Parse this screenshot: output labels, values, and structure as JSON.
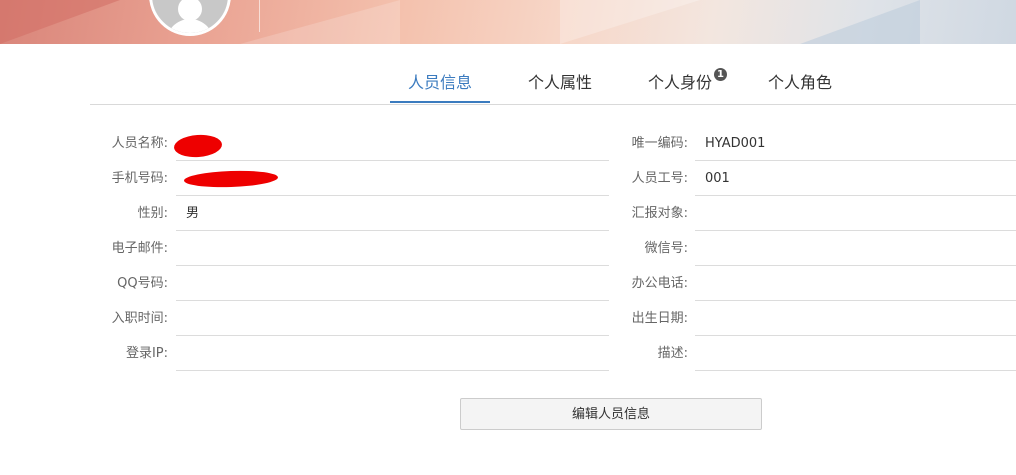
{
  "tabs": [
    {
      "label": "人员信息",
      "active": true
    },
    {
      "label": "个人属性",
      "active": false
    },
    {
      "label": "个人身份",
      "active": false,
      "badge": "1"
    },
    {
      "label": "个人角色",
      "active": false
    }
  ],
  "form_left": [
    {
      "label": "人员名称:",
      "value": ""
    },
    {
      "label": "手机号码:",
      "value": ""
    },
    {
      "label": "性别:",
      "value": "男"
    },
    {
      "label": "电子邮件:",
      "value": ""
    },
    {
      "label": "QQ号码:",
      "value": ""
    },
    {
      "label": "入职时间:",
      "value": ""
    },
    {
      "label": "登录IP:",
      "value": ""
    }
  ],
  "form_right": [
    {
      "label": "唯一编码:",
      "value": "HYAD001"
    },
    {
      "label": "人员工号:",
      "value": "001"
    },
    {
      "label": "汇报对象:",
      "value": ""
    },
    {
      "label": "微信号:",
      "value": ""
    },
    {
      "label": "办公电话:",
      "value": ""
    },
    {
      "label": "出生日期:",
      "value": ""
    },
    {
      "label": "描述:",
      "value": ""
    }
  ],
  "actions": {
    "edit_label": "编辑人员信息"
  },
  "colors": {
    "accent": "#3b7bbf",
    "redaction": "#ee0000",
    "badge": "#555555"
  }
}
